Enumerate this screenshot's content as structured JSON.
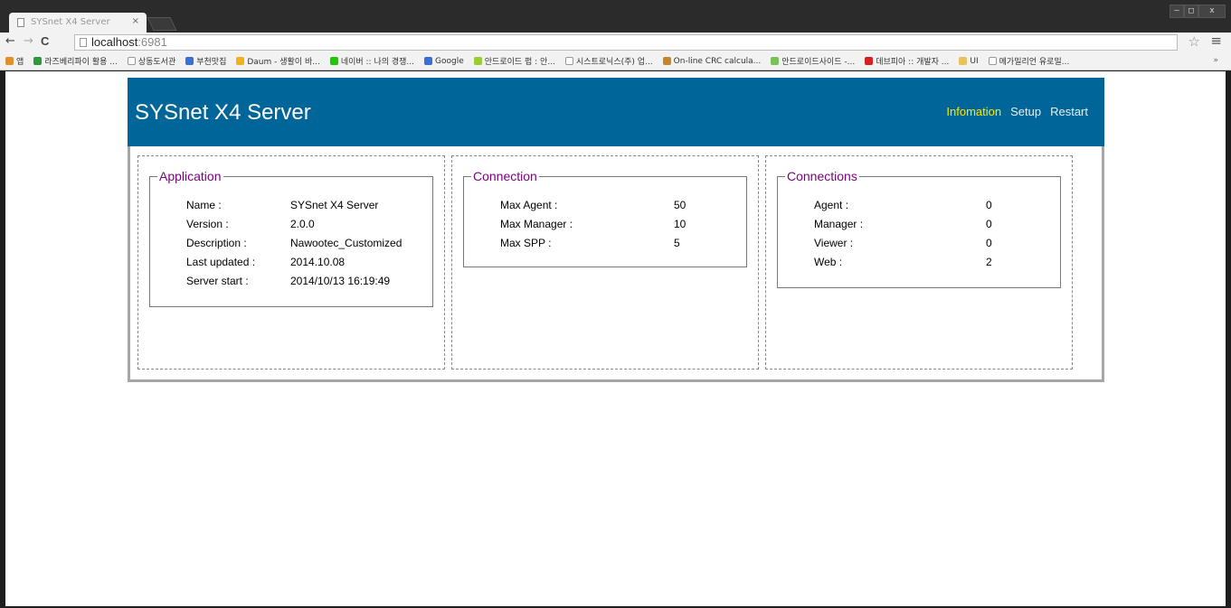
{
  "browser": {
    "tab_title": "SYSnet X4 Server",
    "tab_close": "×",
    "url_host": "localhost",
    "url_port": ":6981",
    "back": "←",
    "forward": "→",
    "reload": "C",
    "star": "☆",
    "menu": "≡",
    "win_min": "–",
    "win_max": "□",
    "win_close": "x",
    "bookmarks_more": "»",
    "bookmarks": [
      {
        "label": "앱",
        "icon": "apps-icon",
        "color": "#e0902b"
      },
      {
        "label": "라즈베리파이 활용 ...",
        "icon": "raspberry-icon",
        "color": "#2a9a3a"
      },
      {
        "label": "상동도서관",
        "icon": "page-icon",
        "color": "#ffffff"
      },
      {
        "label": "부천맛집",
        "icon": "google-icon",
        "color": "#3a6fd8"
      },
      {
        "label": "Daum - 생활이 바...",
        "icon": "daum-icon",
        "color": "#f0b21c"
      },
      {
        "label": "네이버 :: 나의 경쟁...",
        "icon": "naver-icon",
        "color": "#1ec800"
      },
      {
        "label": "Google",
        "icon": "google-icon",
        "color": "#3a6fd8"
      },
      {
        "label": "안드로이드 펍 : 안...",
        "icon": "android-icon",
        "color": "#9acd32"
      },
      {
        "label": "시스트로닉스(주) 업...",
        "icon": "page-icon",
        "color": "#ffffff"
      },
      {
        "label": "On-line CRC calcula...",
        "icon": "crc-icon",
        "color": "#c8862b"
      },
      {
        "label": "안드로이드사이드 -...",
        "icon": "android-icon",
        "color": "#78c257"
      },
      {
        "label": "데브피아 :: 개발자 ...",
        "icon": "devpia-icon",
        "color": "#d62020"
      },
      {
        "label": "UI",
        "icon": "folder-icon",
        "color": "#e8c25c"
      },
      {
        "label": "메가밀리언 유로밀...",
        "icon": "page-icon",
        "color": "#ffffff"
      }
    ]
  },
  "page": {
    "brand": "SYSnet X4 Server",
    "nav": [
      "Infomation",
      "Setup",
      "Restart"
    ],
    "active_nav": "Infomation",
    "application": {
      "title": "Application",
      "rows": [
        {
          "label": "Name :",
          "value": "SYSnet X4 Server"
        },
        {
          "label": "Version :",
          "value": "2.0.0"
        },
        {
          "label": "Description :",
          "value": "Nawootec_Customized"
        },
        {
          "label": "Last updated :",
          "value": "2014.10.08"
        },
        {
          "label": "Server start :",
          "value": "2014/10/13 16:19:49"
        }
      ]
    },
    "connection": {
      "title": "Connection",
      "rows": [
        {
          "label": "Max Agent :",
          "value": "50"
        },
        {
          "label": "Max Manager :",
          "value": "10"
        },
        {
          "label": "Max SPP :",
          "value": "5"
        }
      ]
    },
    "connections": {
      "title": "Connections",
      "rows": [
        {
          "label": "Agent :",
          "value": "0"
        },
        {
          "label": "Manager :",
          "value": "0"
        },
        {
          "label": "Viewer :",
          "value": "0"
        },
        {
          "label": "Web :",
          "value": "2"
        }
      ]
    },
    "colors": {
      "header_bg": "#006699",
      "active_nav": "#ffe600",
      "group_title": "#800080"
    }
  }
}
